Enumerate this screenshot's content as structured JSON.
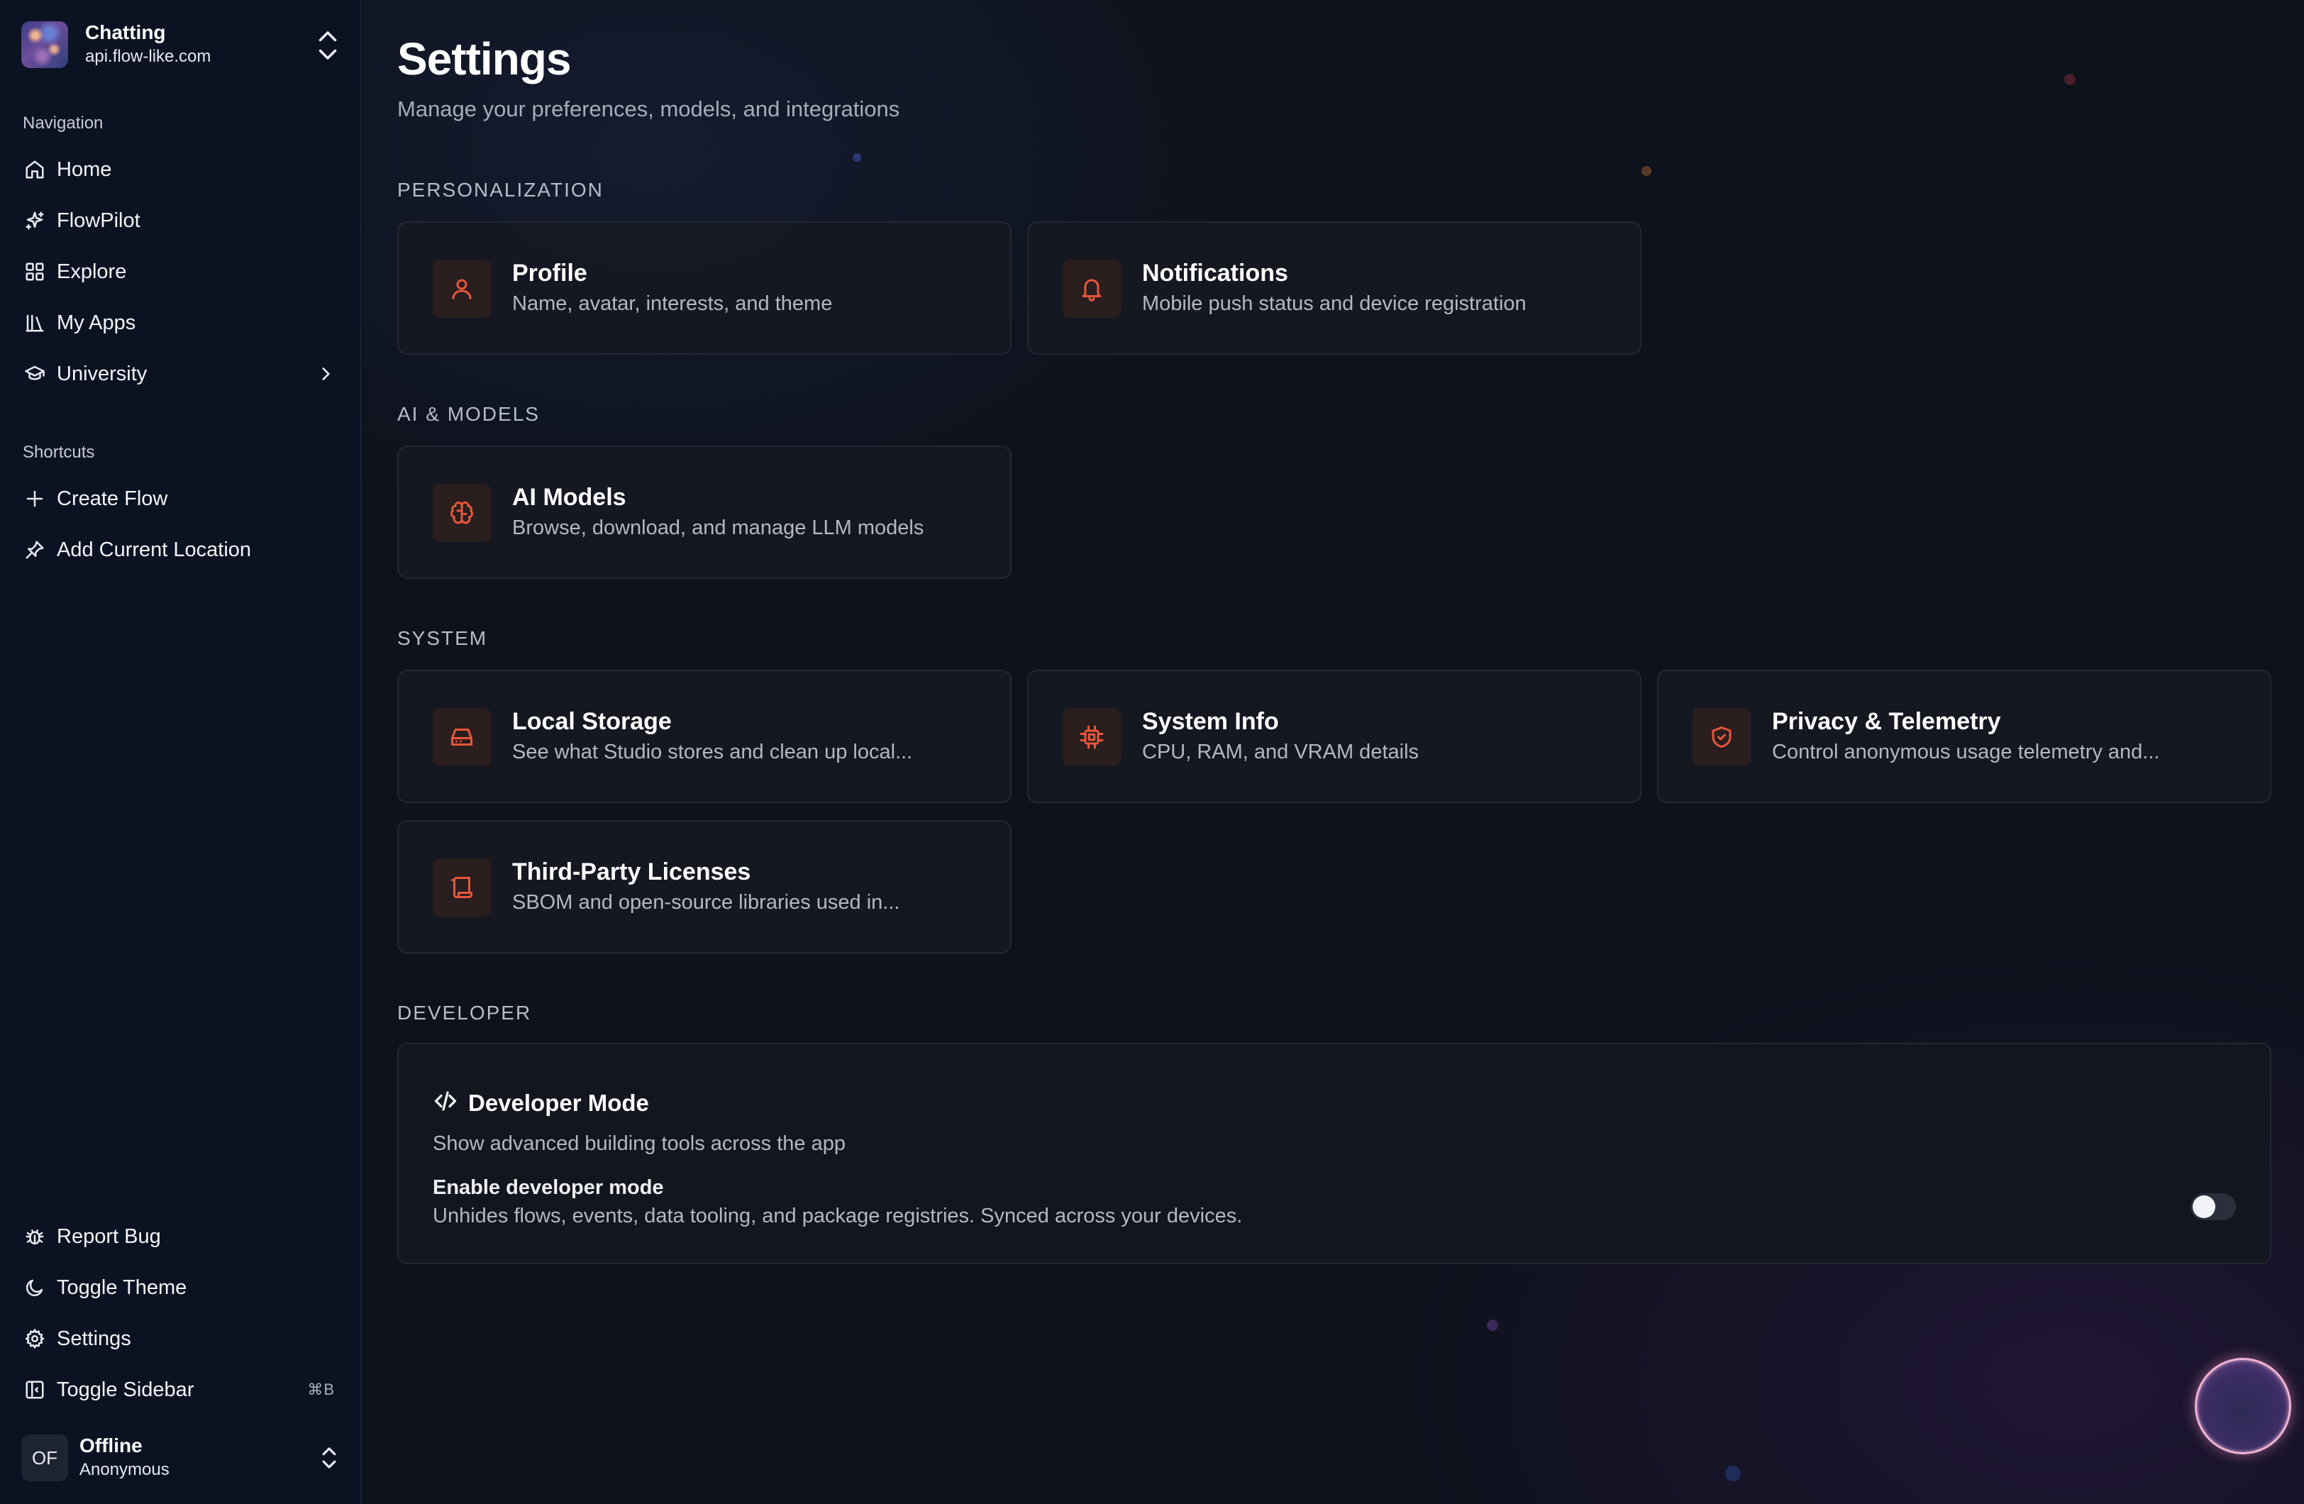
{
  "workspace": {
    "name": "Chatting",
    "host": "api.flow-like.com"
  },
  "sidebar": {
    "navigation_label": "Navigation",
    "navigation": [
      {
        "label": "Home",
        "icon": "home-icon"
      },
      {
        "label": "FlowPilot",
        "icon": "sparkles-icon"
      },
      {
        "label": "Explore",
        "icon": "grid-icon"
      },
      {
        "label": "My Apps",
        "icon": "library-icon"
      },
      {
        "label": "University",
        "icon": "graduation-cap-icon"
      }
    ],
    "shortcuts_label": "Shortcuts",
    "shortcuts": [
      {
        "label": "Create Flow",
        "icon": "plus-icon"
      },
      {
        "label": "Add Current Location",
        "icon": "pin-icon"
      }
    ],
    "footer": [
      {
        "label": "Report Bug",
        "icon": "bug-icon"
      },
      {
        "label": "Toggle Theme",
        "icon": "moon-icon"
      },
      {
        "label": "Settings",
        "icon": "gear-icon"
      },
      {
        "label": "Toggle Sidebar",
        "icon": "panel-left-icon",
        "shortcut": "⌘B"
      }
    ],
    "user": {
      "initials": "OF",
      "name": "Offline",
      "status": "Anonymous"
    }
  },
  "page": {
    "title": "Settings",
    "subtitle": "Manage your preferences, models, and integrations"
  },
  "groups": {
    "personalization": {
      "label": "PERSONALIZATION",
      "cards": [
        {
          "title": "Profile",
          "description": "Name, avatar, interests, and theme",
          "icon": "user-icon"
        },
        {
          "title": "Notifications",
          "description": "Mobile push status and device registration",
          "icon": "bell-icon"
        }
      ]
    },
    "ai_models": {
      "label": "AI & MODELS",
      "cards": [
        {
          "title": "AI Models",
          "description": "Browse, download, and manage LLM models",
          "icon": "brain-icon"
        }
      ]
    },
    "system": {
      "label": "SYSTEM",
      "cards": [
        {
          "title": "Local Storage",
          "description": "See what Studio stores and clean up local...",
          "icon": "hard-drive-icon"
        },
        {
          "title": "System Info",
          "description": "CPU, RAM, and VRAM details",
          "icon": "cpu-icon"
        },
        {
          "title": "Privacy & Telemetry",
          "description": "Control anonymous usage telemetry and...",
          "icon": "shield-check-icon"
        },
        {
          "title": "Third-Party Licenses",
          "description": "SBOM and open-source libraries used in...",
          "icon": "scroll-icon"
        }
      ]
    },
    "developer": {
      "label": "DEVELOPER",
      "title": "Developer Mode",
      "description": "Show advanced building tools across the app",
      "option_label": "Enable developer mode",
      "option_description": "Unhides flows, events, data tooling, and package registries. Synced across your devices.",
      "enabled": false
    }
  },
  "colors": {
    "accent": "#e8573a",
    "background": "#0e121c",
    "sidebar": "#0b1222",
    "card": "#161922"
  }
}
